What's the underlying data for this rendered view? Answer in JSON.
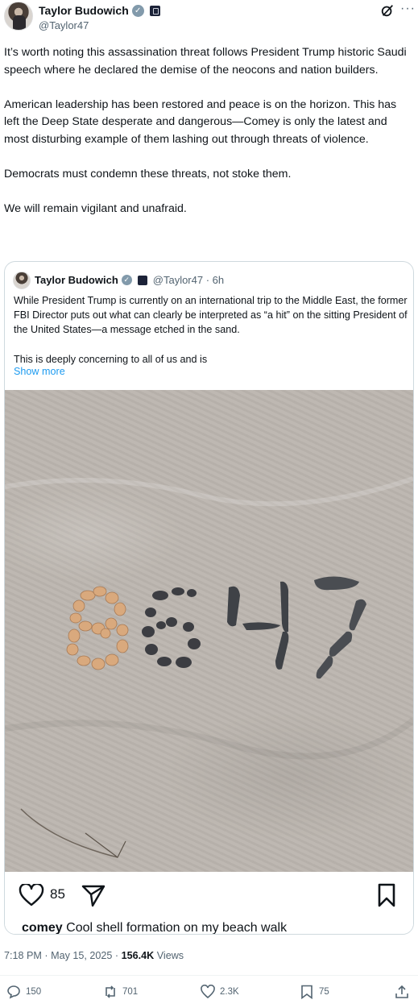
{
  "author": {
    "display_name": "Taylor Budowich",
    "handle": "@Taylor47",
    "verified_icon": "verified-badge-icon",
    "affiliation_icon": "affiliation-badge-icon"
  },
  "header_icons": [
    "grok-icon",
    "more-options-icon"
  ],
  "tweet": {
    "paragraphs": [
      "It’s worth noting this assassination threat follows President Trump historic Saudi speech where he declared the demise of the neocons and nation builders.",
      "American leadership has been restored and peace is on the horizon. This has left the Deep State desperate and dangerous—Comey is only the latest and most disturbing example of them lashing out through threats of violence.",
      "Democrats must condemn these threats, not stoke them.",
      "We will remain vigilant and unafraid."
    ]
  },
  "quoted_tweet": {
    "display_name": "Taylor Budowich",
    "handle_time": "@Taylor47 · 6h",
    "paragraphs": [
      "While President Trump is currently on an international trip to the Middle East, the former FBI Director puts out what can clearly be interpreted as “a hit” on the sitting President of the United States—a message etched in the sand.",
      "This is deeply concerning to all of us and is"
    ],
    "show_more": "Show more",
    "embedded_post": {
      "like_count": "85",
      "caption_user": "comey",
      "caption_text": "Cool shell formation on my beach walk"
    }
  },
  "meta": {
    "timestamp": "7:18 PM · May 15, 2025 · ",
    "views_count": "156.4K",
    "views_label": " Views"
  },
  "actions": {
    "replies": "150",
    "reposts": "701",
    "likes": "2.3K",
    "bookmarks": "75"
  },
  "colors": {
    "text": "#0f1419",
    "secondary": "#536471",
    "link": "#1d9bf0",
    "border": "#cfd9de",
    "sand": "#bcb6af"
  }
}
